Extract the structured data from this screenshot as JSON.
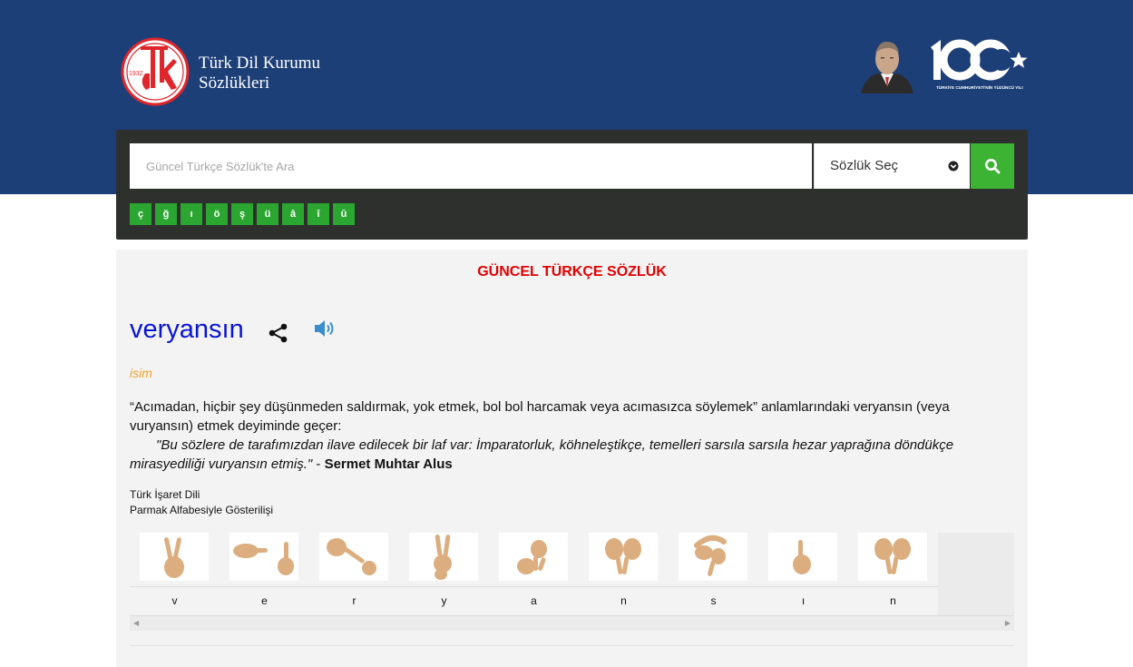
{
  "header": {
    "brand_line1": "Türk Dil Kurumu",
    "brand_line2": "Sözlükleri",
    "logo_year": "1932",
    "centennial_caption": "TÜRKİYE CUMHURİYETİ'NİN YÜZÜNCÜ YILI",
    "colors": {
      "band": "#1d3f78",
      "accent": "#3cb333",
      "logo_red": "#e0262b"
    }
  },
  "search": {
    "placeholder": "Güncel Türkçe Sözlük'te Ara",
    "value": "",
    "dictionary_selected": "Sözlük Seç",
    "button_icon": "search-icon"
  },
  "special_letters": [
    "ç",
    "ğ",
    "ı",
    "ö",
    "ş",
    "ü",
    "â",
    "î",
    "û"
  ],
  "main": {
    "dictionary_title": "GÜNCEL TÜRKÇE SÖZLÜK",
    "word": "veryansın",
    "part_of_speech": "isim",
    "definition": "“Acımadan, hiçbir şey düşünmeden saldırmak, yok etmek, bol bol harcamak veya acımasızca söylemek” anlamlarındaki veryansın (veya vuryansın) etmek deyiminde geçer:",
    "example_quote": "\"Bu sözlere de tarafımızdan ilave edilecek bir laf var: İmparatorluk, köhneleştikçe, temelleri sarsıla sarsıla hezar yaprağına döndükçe mirasyediliği vuryansın etmiş.\"",
    "example_separator": " - ",
    "example_author": "Sermet Muhtar Alus",
    "sign_language_title": "Türk İşaret Dili",
    "sign_language_subtitle": "Parmak Alfabesiyle Gösterilişi",
    "sign_letters": [
      "v",
      "e",
      "r",
      "y",
      "a",
      "n",
      "s",
      "ı",
      "n"
    ],
    "icons": [
      "share-icon",
      "speaker-icon"
    ]
  }
}
